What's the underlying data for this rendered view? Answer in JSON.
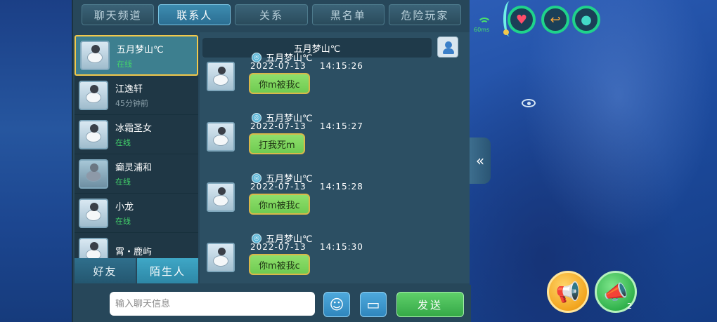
{
  "tabs": [
    {
      "label": "聊天频道"
    },
    {
      "label": "联系人"
    },
    {
      "label": "关系"
    },
    {
      "label": "黑名单"
    },
    {
      "label": "危险玩家"
    }
  ],
  "contacts": [
    {
      "name": "五月梦山℃",
      "status": "在线"
    },
    {
      "name": "江逸轩",
      "status": "45分钟前"
    },
    {
      "name": "冰霜圣女",
      "status": "在线"
    },
    {
      "name": "癫灵浦和",
      "status": "在线"
    },
    {
      "name": "小龙",
      "status": "在线"
    },
    {
      "name": "霄・鹿屿",
      "status": ""
    }
  ],
  "contact_tabs": {
    "friends": "好友",
    "strangers": "陌生人"
  },
  "chat": {
    "header_name": "五月梦山℃",
    "messages": [
      {
        "sender": "五月梦山℃",
        "date": "2022-07-13",
        "time": "14:15:26",
        "text": "你m被我c"
      },
      {
        "sender": "五月梦山℃",
        "date": "2022-07-13",
        "time": "14:15:27",
        "text": "打我死m"
      },
      {
        "sender": "五月梦山℃",
        "date": "2022-07-13",
        "time": "14:15:28",
        "text": "你m被我c"
      },
      {
        "sender": "五月梦山℃",
        "date": "2022-07-13",
        "time": "14:15:30",
        "text": "你m被我c"
      }
    ]
  },
  "input": {
    "placeholder": "输入聊天信息",
    "value": ""
  },
  "buttons": {
    "send": "发送"
  },
  "hud": {
    "signal_label": "60ms",
    "megaphone_count": "2"
  },
  "icons": {
    "emoji": "emoji-icon",
    "chat_bubble": "chat-bubble-icon",
    "collapse": "double-chevron-left-icon",
    "health": "heart-icon",
    "hunger": "hunger-icon",
    "water": "water-drop-icon",
    "eye": "eye-icon",
    "megaphone": "megaphone-icon"
  },
  "colors": {
    "accent_tab": "#2b6e92",
    "online": "#43d36b",
    "bubble": "#6fcb52",
    "send": "#35a847"
  }
}
